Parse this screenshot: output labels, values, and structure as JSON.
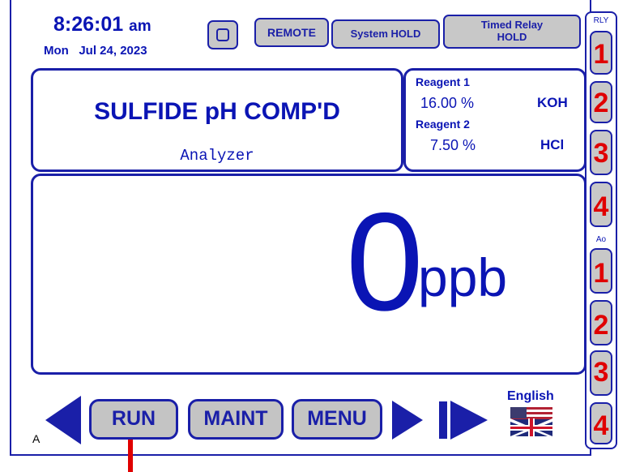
{
  "header": {
    "time": "8:26:01",
    "ampm": "am",
    "day": "Mon",
    "date": "Jul 24, 2023",
    "status": {
      "remote": "REMOTE",
      "system_hold": "System HOLD",
      "timed_relay_line1": "Timed Relay",
      "timed_relay_line2": "HOLD"
    }
  },
  "analyzer": {
    "title": "SULFIDE pH COMP'D",
    "subtitle": "Analyzer"
  },
  "reagents": [
    {
      "label": "Reagent 1",
      "value": "16.00 %",
      "chemical": "KOH"
    },
    {
      "label": "Reagent 2",
      "value": "7.50 %",
      "chemical": "HCl"
    }
  ],
  "reading": {
    "value": "0",
    "unit": "ppb"
  },
  "sidebar": {
    "relay_header": "RLY",
    "relays": [
      "1",
      "2",
      "3",
      "4"
    ],
    "ao_header": "Ao",
    "outputs": [
      "1",
      "2",
      "3",
      "4"
    ]
  },
  "footer": {
    "channel": "A",
    "run": "RUN",
    "maint": "MAINT",
    "menu": "MENU",
    "language": "English"
  },
  "colors": {
    "frame": "#1a1fa8",
    "text": "#0a14b4",
    "relay_number": "#e00000",
    "button_fill": "#c4c4c4",
    "indicator": "#e00000"
  }
}
